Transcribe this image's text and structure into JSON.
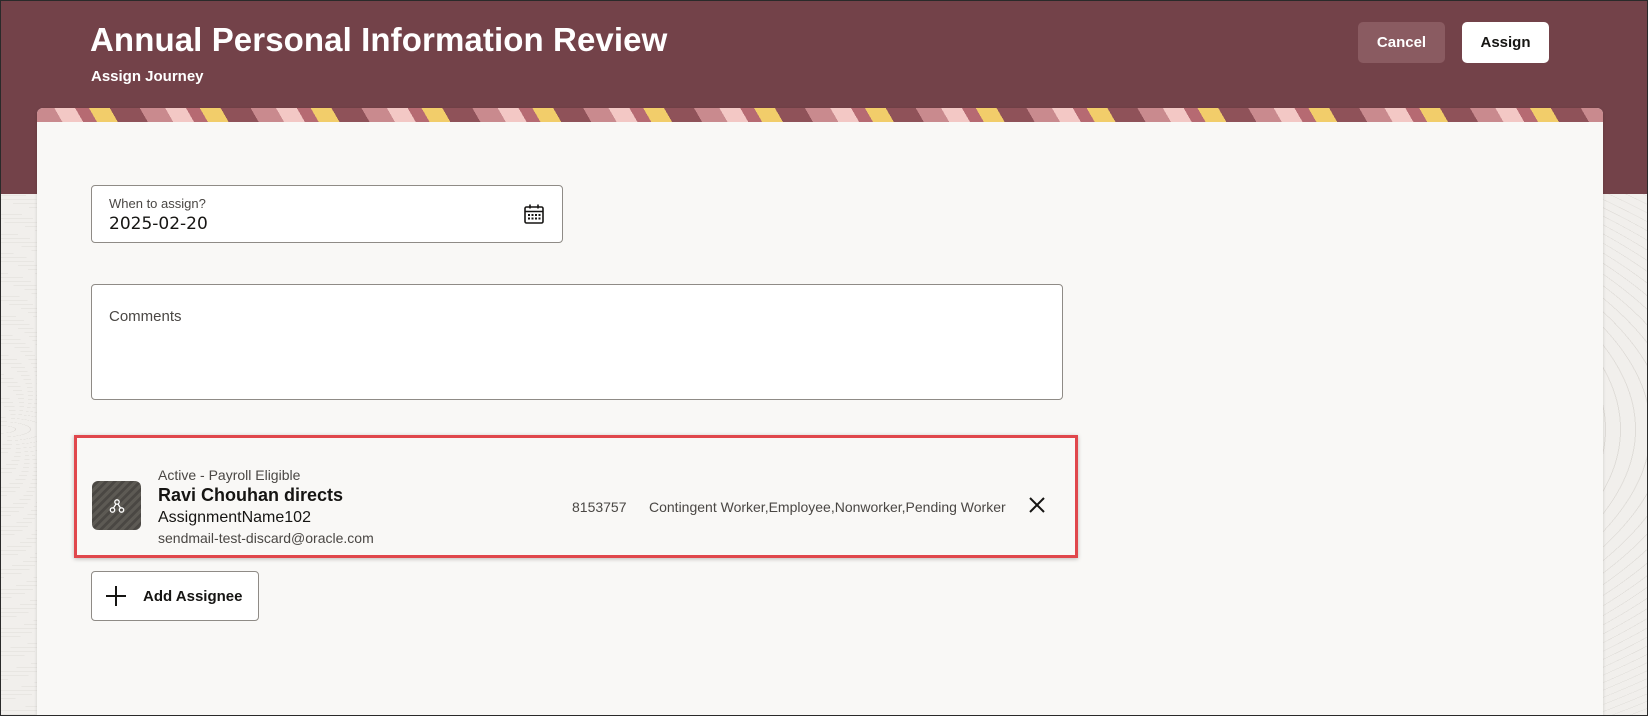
{
  "header": {
    "title": "Annual Personal Information Review",
    "subtitle": "Assign Journey",
    "cancel_label": "Cancel",
    "assign_label": "Assign"
  },
  "form": {
    "date_label": "When to assign?",
    "date_value": "2025-02-20",
    "comments_label": "Comments"
  },
  "assignee": {
    "status": "Active - Payroll Eligible",
    "name": "Ravi Chouhan directs",
    "assignment_name": "AssignmentName102",
    "email": "sendmail-test-discard@oracle.com",
    "person_number": "8153757",
    "worker_types": "Contingent Worker,Employee,Nonworker,Pending Worker",
    "avatar_icon": "org-hierarchy-icon",
    "remove_icon": "close-icon"
  },
  "actions": {
    "add_assignee_label": "Add Assignee",
    "add_icon": "plus-icon"
  },
  "colors": {
    "header_bg": "#734249",
    "highlight_border": "#e0474c",
    "cancel_bg": "#8a5b61"
  }
}
